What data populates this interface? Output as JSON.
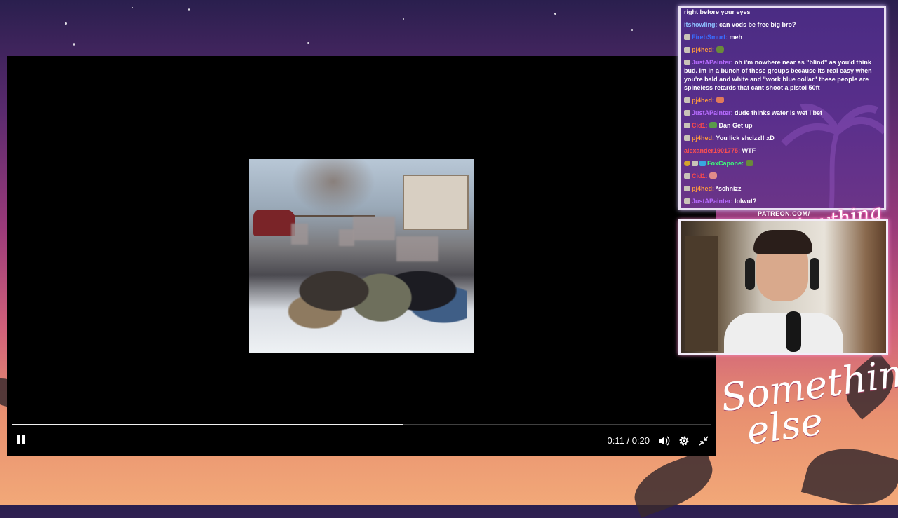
{
  "stream_overlay": {
    "patreon_text": "PATREON.COM/",
    "brand_small": "Anything else?",
    "brand_large_line1": "Something",
    "brand_large_line2": "else"
  },
  "player": {
    "time_current": "0:11",
    "time_total": "0:20",
    "time_display": "0:11 / 0:20",
    "progress": 0.56,
    "state": "playing",
    "icons": [
      "pause-icon",
      "volume-icon",
      "settings-gear-icon",
      "exit-fullscreen-icon"
    ]
  },
  "chat": {
    "messages": [
      {
        "user": "",
        "color": "#ffffff",
        "text": "right before your eyes",
        "badges": []
      },
      {
        "user": "itshowling",
        "color": "#8ec0ff",
        "text": "can vods be free big bro?",
        "badges": []
      },
      {
        "user": "FirebSmurf",
        "color": "#3a6cff",
        "text": "meh",
        "badges": [
          "badge"
        ]
      },
      {
        "user": "pj4hed",
        "color": "#ff9a3c",
        "text": "",
        "emote": "#6a8a3a",
        "badges": [
          "badge"
        ]
      },
      {
        "user": "JustAPainter",
        "color": "#b76cff",
        "text": "oh i'm nowhere near as \"blind\" as you'd think bud. im in a bunch of these groups because its real easy when you're bald and white and \"work blue collar\" these people are spineless retards that cant shoot a pistol 50ft",
        "badges": [
          "badge"
        ]
      },
      {
        "user": "pj4hed",
        "color": "#ff9a3c",
        "text": "",
        "emote": "#e07a5a",
        "badges": [
          "badge"
        ]
      },
      {
        "user": "JustAPainter",
        "color": "#b76cff",
        "text": "dude thinks water is wet i bet",
        "badges": [
          "badge"
        ]
      },
      {
        "user": "Cid1",
        "color": "#ff4a4a",
        "text": "Dan Get up",
        "emote": "#5a9a4a",
        "badges": [
          "badge"
        ]
      },
      {
        "user": "pj4hed",
        "color": "#ff9a3c",
        "text": "You lick shcizz!! xD",
        "badges": [
          "badge"
        ]
      },
      {
        "user": "alexander1901775",
        "color": "#ff5050",
        "text": "WTF",
        "badges": []
      },
      {
        "user": "FoxCapone",
        "color": "#3cff7a",
        "text": "",
        "emote": "#6a8a3a",
        "badges": [
          "gold",
          "badge",
          "blue"
        ]
      },
      {
        "user": "Cid1",
        "color": "#ff4a4a",
        "text": "",
        "emote": "#e08a8a",
        "badges": [
          "badge"
        ]
      },
      {
        "user": "pj4hed",
        "color": "#ff9a3c",
        "text": "*schnizz",
        "badges": [
          "badge"
        ]
      },
      {
        "user": "JustAPainter",
        "color": "#b76cff",
        "text": "lolwut?",
        "badges": [
          "badge"
        ]
      }
    ]
  },
  "colors": {
    "player_bg": "#000000",
    "chat_bg": "#4a2c83",
    "chat_border": "#e8e0f2",
    "cam_border_glow": "#ff8fd1"
  }
}
